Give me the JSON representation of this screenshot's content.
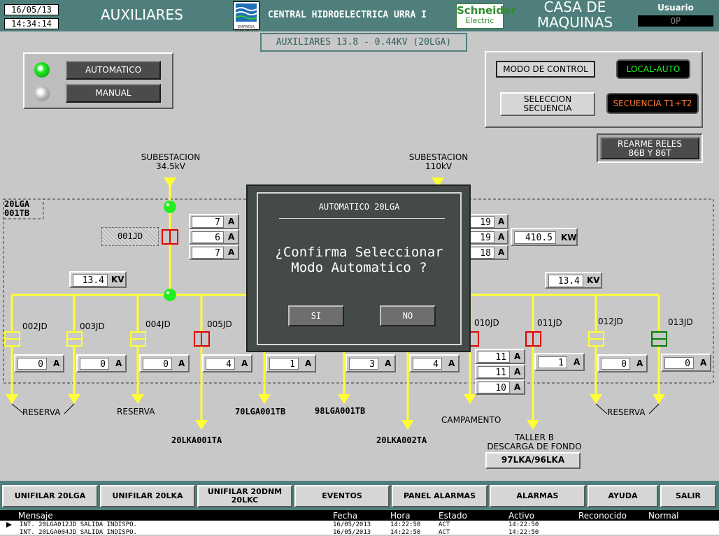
{
  "header": {
    "date": "16/05/13",
    "time": "14:34:14",
    "title_left": "AUXILIARES",
    "center_title": "CENTRAL HIDROELECTRICA URRA I",
    "logo_urra_text": "EMPRESA URRA SA ESP",
    "logo_schneider_line1": "Schneider",
    "logo_schneider_line2": "Electric",
    "title_right_1": "CASA DE",
    "title_right_2": "MAQUINAS",
    "user_label": "Usuario",
    "user_value": "OP"
  },
  "subtitle": "AUXILIARES 13.8 - 0.44KV (20LGA)",
  "mode_panel": {
    "auto_label": "AUTOMATICO",
    "manual_label": "MANUAL"
  },
  "control_panel": {
    "modo_label": "MODO DE CONTROL",
    "modo_value": "LOCAL-AUTO",
    "sel_line1": "SELECCION",
    "sel_line2": "SECUENCIA",
    "seq_value": "SECUENCIA T1+T2"
  },
  "rearme": {
    "line1": "REARME RELES",
    "line2": "86B Y 86T"
  },
  "subestaciones": {
    "left": {
      "line1": "SUBESTACION",
      "line2": "34.5kV"
    },
    "right": {
      "line1": "SUBESTACION",
      "line2": "110kV"
    }
  },
  "bus_label": {
    "line1": "20LGA",
    "line2": "001TB"
  },
  "breaker_001": "001JD",
  "left_currents": [
    "7",
    "6",
    "7"
  ],
  "right_currents": [
    "19",
    "19",
    "18"
  ],
  "power": {
    "value": "410.5",
    "unit": "KW"
  },
  "voltage_left": {
    "value": "13.4",
    "unit": "KV"
  },
  "voltage_right": {
    "value": "13.4",
    "unit": "KV"
  },
  "unit_a": "A",
  "feeders": [
    {
      "name": "002JD",
      "current": "0",
      "load": "RESERVA"
    },
    {
      "name": "003JD",
      "current": "0",
      "load": ""
    },
    {
      "name": "004JD",
      "current": "0",
      "load": "RESERVA"
    },
    {
      "name": "005JD",
      "current": "4",
      "load": "20LKA001TA"
    },
    {
      "name": "",
      "current": "1",
      "load": "70LGA001TB"
    },
    {
      "name": "",
      "current": "3",
      "load": "98LGA001TB"
    },
    {
      "name": "",
      "current": "4",
      "load": "20LKA002TA"
    },
    {
      "name": "010JD",
      "current": "",
      "load": "CAMPAMENTO"
    },
    {
      "name": "011JD",
      "current": "1",
      "load": ""
    },
    {
      "name": "012JD",
      "current": "0",
      "load": "RESERVA"
    },
    {
      "name": "013JD",
      "current": "0",
      "load": ""
    }
  ],
  "campamento_currents": [
    "11",
    "11",
    "10"
  ],
  "taller": {
    "line1": "TALLER B",
    "line2": "DESCARGA DE FONDO",
    "button": "97LKA/96LKA"
  },
  "dialog": {
    "title": "AUTOMATICO 20LGA",
    "line1": "¿Confirma Seleccionar",
    "line2": "Modo Automatico ?",
    "yes": "SI",
    "no": "NO"
  },
  "nav": [
    "UNIFILAR 20LGA",
    "UNIFILAR 20LKA",
    "UNIFILAR 20DNM 20LKC",
    "EVENTOS",
    "PANEL ALARMAS",
    "ALARMAS",
    "AYUDA",
    "SALIR"
  ],
  "log": {
    "headers": {
      "mensaje": "Mensaje",
      "fecha": "Fecha",
      "hora": "Hora",
      "estado": "Estado",
      "activo": "Activo",
      "reconocido": "Reconocido",
      "normal": "Normal"
    },
    "rows": [
      {
        "mensaje": "INT. 20LGA012JD SALIDA INDISPO.",
        "fecha": "16/05/2013",
        "hora": "14:22:50",
        "estado": "ACT",
        "activo": "14:22:50"
      },
      {
        "mensaje": "INT. 20LGA004JD SALIDA INDISPO.",
        "fecha": "16/05/2013",
        "hora": "14:22:50",
        "estado": "ACT",
        "activo": "14:22:50"
      }
    ]
  },
  "colors": {
    "header": "#4f7f7c",
    "bus": "#ffff33",
    "breaker_red": "#e00000",
    "breaker_yellow": "#ffff33",
    "breaker_green": "#008000",
    "led_green": "#22ee22"
  }
}
